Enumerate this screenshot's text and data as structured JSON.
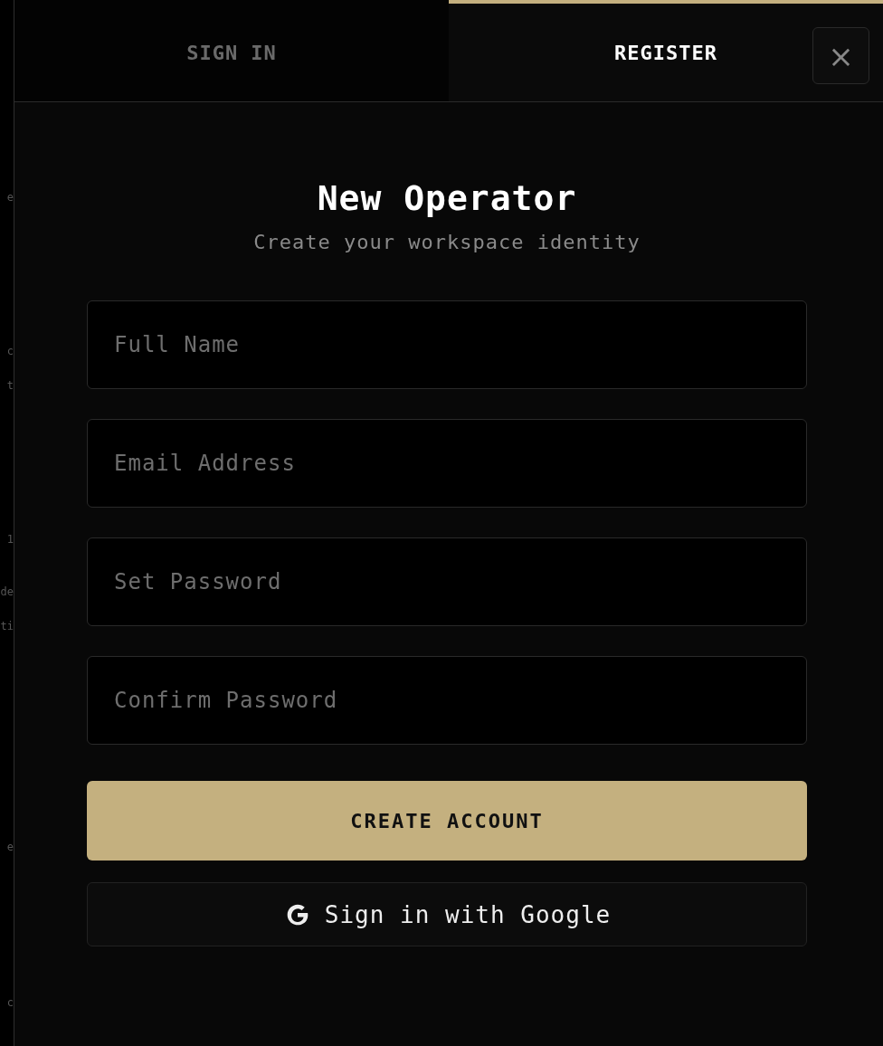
{
  "background_fragments": [
    "e",
    "c",
    "t",
    "1",
    "de",
    "ti",
    "e",
    "c"
  ],
  "tabs": [
    {
      "label": "SIGN IN",
      "selected": false
    },
    {
      "label": "REGISTER",
      "selected": true
    }
  ],
  "close": {
    "label": "×"
  },
  "title": "New Operator",
  "subtitle": "Create your workspace identity",
  "fields": [
    {
      "placeholder": "Full Name"
    },
    {
      "placeholder": "Email Address"
    },
    {
      "placeholder": "Set Password"
    },
    {
      "placeholder": "Confirm Password"
    }
  ],
  "submit": "CREATE ACCOUNT",
  "google": "Sign in with Google"
}
